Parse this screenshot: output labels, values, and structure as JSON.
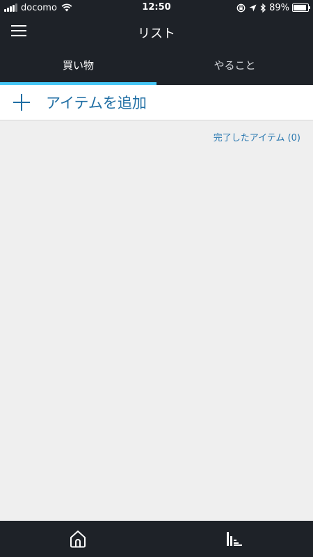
{
  "status_bar": {
    "carrier": "docomo",
    "time": "12:50",
    "battery_percent": "89%",
    "battery_level": 0.89,
    "icons": [
      "signal-icon",
      "wifi-icon",
      "lock-rotation-icon",
      "location-icon",
      "bluetooth-icon",
      "battery-icon"
    ]
  },
  "app_bar": {
    "title": "リスト",
    "menu_icon": "hamburger-menu-icon"
  },
  "tabs": [
    {
      "label": "買い物",
      "active": true
    },
    {
      "label": "やること",
      "active": false
    }
  ],
  "add_item": {
    "icon": "plus-icon",
    "label": "アイテムを追加"
  },
  "completed": {
    "label": "完了したアイテム (0)"
  },
  "bottom_nav": {
    "items": [
      {
        "icon": "home-icon"
      },
      {
        "icon": "music-player-icon"
      }
    ]
  },
  "colors": {
    "bar_background": "#1e2228",
    "tab_indicator": "#46c6f5",
    "accent_blue": "#1f6ea4",
    "content_background": "#efefef"
  }
}
